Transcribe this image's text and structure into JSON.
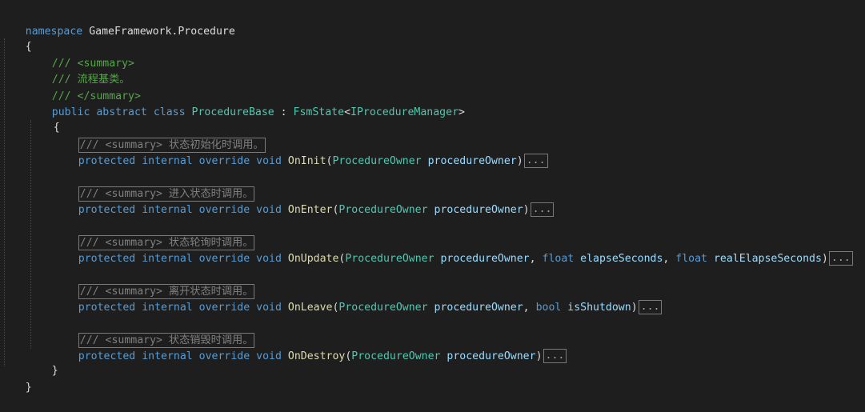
{
  "namespace_line": {
    "keyword": "namespace",
    "name": "GameFramework.Procedure"
  },
  "braces": {
    "open": "{",
    "close": "}"
  },
  "doc": {
    "line1": "/// <summary>",
    "line2": "/// 流程基类。",
    "line3": "/// </summary>"
  },
  "class_decl": {
    "public": "public",
    "abstract": "abstract",
    "class": "class",
    "name": "ProcedureBase",
    "colon": " : ",
    "base": "FsmState",
    "lt": "<",
    "generic": "IProcedureManager",
    "gt": ">"
  },
  "methods": [
    {
      "summary": "/// <summary> 状态初始化时调用。",
      "protected": "protected",
      "internal": "internal",
      "override": "override",
      "void": "void",
      "name": "OnInit",
      "open": "(",
      "p1_type": "ProcedureOwner",
      "p1_name": "procedureOwner",
      "close": ")",
      "ellipsis": "..."
    },
    {
      "summary": "/// <summary> 进入状态时调用。",
      "protected": "protected",
      "internal": "internal",
      "override": "override",
      "void": "void",
      "name": "OnEnter",
      "open": "(",
      "p1_type": "ProcedureOwner",
      "p1_name": "procedureOwner",
      "close": ")",
      "ellipsis": "..."
    },
    {
      "summary": "/// <summary> 状态轮询时调用。",
      "protected": "protected",
      "internal": "internal",
      "override": "override",
      "void": "void",
      "name": "OnUpdate",
      "open": "(",
      "p1_type": "ProcedureOwner",
      "p1_name": "procedureOwner",
      "comma1": ", ",
      "p2_type": "float",
      "p2_name": "elapseSeconds",
      "comma2": ", ",
      "p3_type": "float",
      "p3_name": "realElapseSeconds",
      "close": ")",
      "ellipsis": "..."
    },
    {
      "summary": "/// <summary> 离开状态时调用。",
      "protected": "protected",
      "internal": "internal",
      "override": "override",
      "void": "void",
      "name": "OnLeave",
      "open": "(",
      "p1_type": "ProcedureOwner",
      "p1_name": "procedureOwner",
      "comma1": ", ",
      "p2_type": "bool",
      "p2_name": "isShutdown",
      "close": ")",
      "ellipsis": "..."
    },
    {
      "summary": "/// <summary> 状态销毁时调用。",
      "protected": "protected",
      "internal": "internal",
      "override": "override",
      "void": "void",
      "name": "OnDestroy",
      "open": "(",
      "p1_type": "ProcedureOwner",
      "p1_name": "procedureOwner",
      "close": ")",
      "ellipsis": "..."
    }
  ],
  "colors": {
    "background": "#1e1e1e",
    "keyword": "#569cd6",
    "type": "#4ec9b0",
    "method": "#dcdcaa",
    "parameter": "#9cdcfe",
    "comment": "#57a64a",
    "collapsed": "#808080",
    "text": "#dcdcdc"
  }
}
